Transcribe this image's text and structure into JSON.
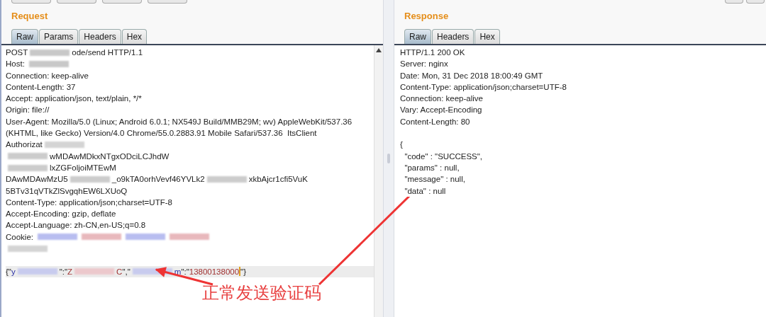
{
  "request": {
    "title": "Request",
    "tabs": [
      {
        "label": "Raw",
        "selected": true
      },
      {
        "label": "Params",
        "selected": false
      },
      {
        "label": "Headers",
        "selected": false
      },
      {
        "label": "Hex",
        "selected": false
      }
    ],
    "headers": [
      {
        "parts": [
          {
            "kind": "text",
            "text": "POST"
          },
          {
            "kind": "redacted",
            "color": "#c8c8c8"
          },
          {
            "kind": "text",
            "text": "ode/send HTTP/1.1"
          }
        ]
      },
      {
        "parts": [
          {
            "kind": "text",
            "text": "Host: "
          },
          {
            "kind": "redacted",
            "color": "#c8c8c8"
          }
        ]
      },
      {
        "parts": [
          {
            "kind": "text",
            "text": "Connection: keep-alive"
          }
        ]
      },
      {
        "parts": [
          {
            "kind": "text",
            "text": "Content-Length: 37"
          }
        ]
      },
      {
        "parts": [
          {
            "kind": "text",
            "text": "Accept: application/json, text/plain, */*"
          }
        ]
      },
      {
        "parts": [
          {
            "kind": "text",
            "text": "Origin: file://"
          }
        ]
      },
      {
        "parts": [
          {
            "kind": "text",
            "text": "User-Agent: Mozilla/5.0 (Linux; Android 6.0.1; NX549J Build/MMB29M; wv) AppleWebKit/537.36"
          }
        ]
      },
      {
        "parts": [
          {
            "kind": "text",
            "text": "(KHTML, like Gecko) Version/4.0 Chrome/55.0.2883.91 Mobile Safari/537.36  ItsClient"
          }
        ]
      },
      {
        "parts": [
          {
            "kind": "text",
            "text": "Authorizat"
          },
          {
            "kind": "redacted",
            "color": "#d4d4d4"
          }
        ]
      },
      {
        "parts": [
          {
            "kind": "redacted",
            "color": "#cccccc"
          },
          {
            "kind": "text",
            "text": "wMDAwMDkxNTgxODciLCJhdW"
          }
        ]
      },
      {
        "parts": [
          {
            "kind": "redacted",
            "color": "#cccccc"
          },
          {
            "kind": "text",
            "text": "lxZGFoljoiMTEwM"
          }
        ]
      },
      {
        "parts": [
          {
            "kind": "text",
            "text": "DAwMDAwMzU5"
          },
          {
            "kind": "redacted",
            "color": "#cccccc"
          },
          {
            "kind": "text",
            "text": "_o9kTA0orhVevf46YVLk2"
          },
          {
            "kind": "redacted",
            "color": "#cccccc"
          },
          {
            "kind": "text",
            "text": "xkbAjcr1cfi5VuK"
          }
        ]
      },
      {
        "parts": [
          {
            "kind": "text",
            "text": "5BTv31qVTkZlSvgqhEW6LXUoQ"
          }
        ]
      },
      {
        "parts": [
          {
            "kind": "text",
            "text": "Content-Type: application/json;charset=UTF-8"
          }
        ]
      },
      {
        "parts": [
          {
            "kind": "text",
            "text": "Accept-Encoding: gzip, deflate"
          }
        ]
      },
      {
        "parts": [
          {
            "kind": "text",
            "text": "Accept-Language: zh-CN,en-US;q=0.8"
          }
        ]
      },
      {
        "parts": [
          {
            "kind": "text",
            "text": "Cookie: "
          },
          {
            "kind": "redacted",
            "color": "#b8bdf0"
          },
          {
            "kind": "redacted",
            "color": "#e8b8bc"
          },
          {
            "kind": "redacted",
            "color": "#b8bdf0"
          },
          {
            "kind": "redacted",
            "color": "#e8b8bc"
          }
        ]
      },
      {
        "parts": [
          {
            "kind": "redacted",
            "color": "#d4d4d4"
          }
        ]
      }
    ],
    "body": [
      {
        "highlighted": true,
        "parts": [
          {
            "kind": "text",
            "text": "{\""
          },
          {
            "kind": "key",
            "text": "y"
          },
          {
            "kind": "redacted",
            "color": "#c8cbee"
          },
          {
            "kind": "text",
            "text": "\":\""
          },
          {
            "kind": "value",
            "text": "Z"
          },
          {
            "kind": "redacted",
            "color": "#ecc8cc"
          },
          {
            "kind": "value",
            "text": "C"
          },
          {
            "kind": "text",
            "text": "\",\""
          },
          {
            "kind": "redacted",
            "color": "#c8cbee"
          },
          {
            "kind": "key",
            "text": "m"
          },
          {
            "kind": "text",
            "text": "\":\""
          },
          {
            "kind": "value",
            "text": "13800138000"
          },
          {
            "kind": "caret"
          },
          {
            "kind": "text",
            "text": "\"}"
          }
        ]
      }
    ]
  },
  "response": {
    "title": "Response",
    "tabs": [
      {
        "label": "Raw",
        "selected": true
      },
      {
        "label": "Headers",
        "selected": false
      },
      {
        "label": "Hex",
        "selected": false
      }
    ],
    "headers": [
      "HTTP/1.1 200 OK",
      "Server: nginx",
      "Date: Mon, 31 Dec 2018 18:00:49 GMT",
      "Content-Type: application/json;charset=UTF-8",
      "Connection: keep-alive",
      "Vary: Accept-Encoding",
      "Content-Length: 80"
    ],
    "body": [
      "{",
      "  \"code\" : \"SUCCESS\",",
      "  \"params\" : null,",
      "  \"message\" : null,",
      "  \"data\" : null"
    ]
  },
  "annotation": {
    "text": "正常发送验证码"
  }
}
